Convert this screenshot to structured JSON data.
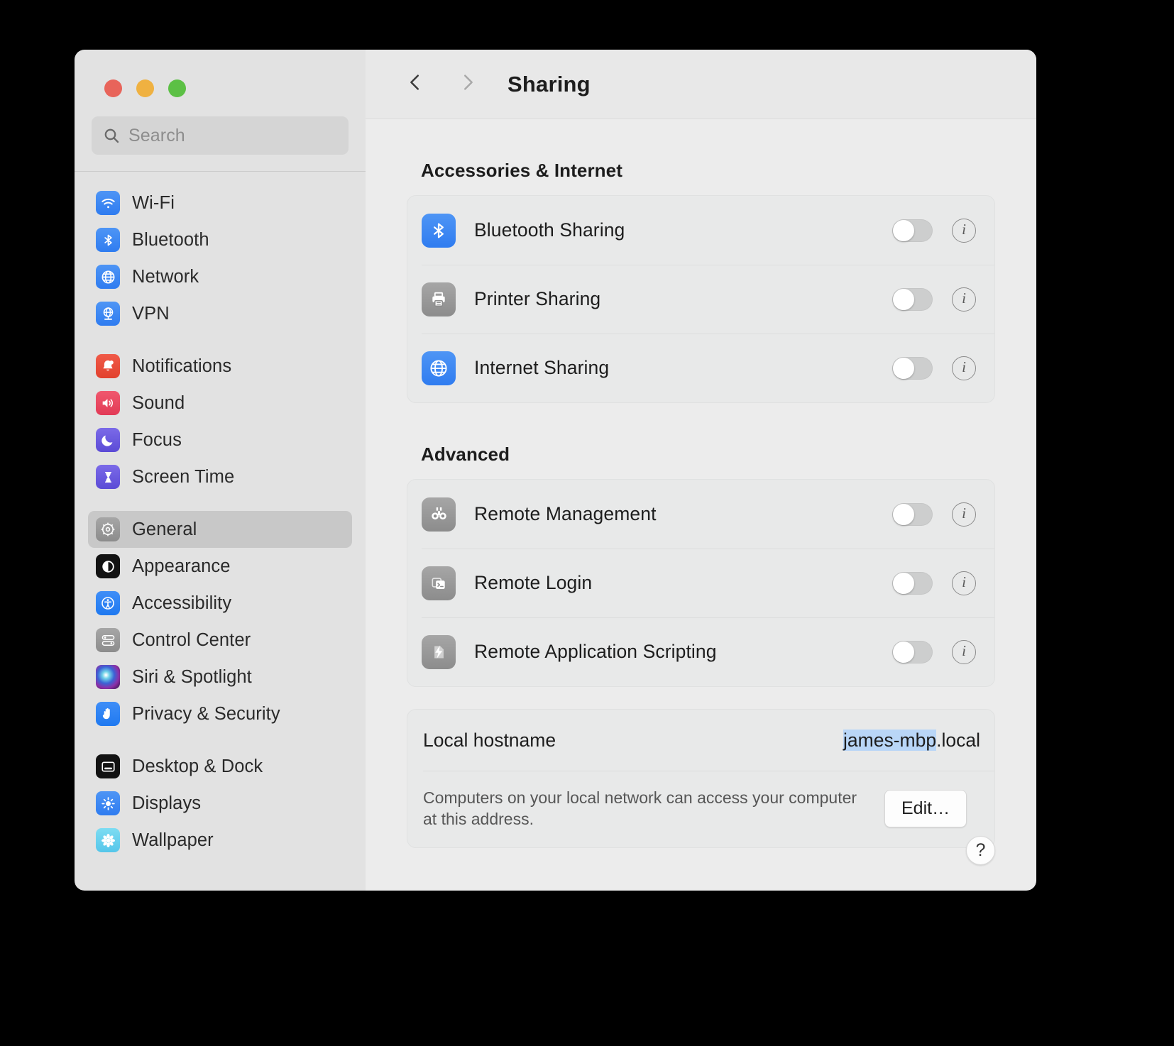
{
  "window": {
    "traffic_lights": [
      {
        "name": "close",
        "color": "#e8645a"
      },
      {
        "name": "minimize",
        "color": "#efb141"
      },
      {
        "name": "zoom",
        "color": "#5cc045"
      }
    ]
  },
  "search": {
    "placeholder": "Search",
    "value": "",
    "icon": "search-icon"
  },
  "sidebar": {
    "groups": [
      {
        "items": [
          {
            "label": "Wi-Fi",
            "icon": "wifi-icon",
            "selected": false
          },
          {
            "label": "Bluetooth",
            "icon": "bluetooth-icon",
            "selected": false
          },
          {
            "label": "Network",
            "icon": "globe-icon",
            "selected": false
          },
          {
            "label": "VPN",
            "icon": "vpn-globe-icon",
            "selected": false
          }
        ]
      },
      {
        "items": [
          {
            "label": "Notifications",
            "icon": "bell-icon",
            "selected": false
          },
          {
            "label": "Sound",
            "icon": "speaker-icon",
            "selected": false
          },
          {
            "label": "Focus",
            "icon": "moon-icon",
            "selected": false
          },
          {
            "label": "Screen Time",
            "icon": "hourglass-icon",
            "selected": false
          }
        ]
      },
      {
        "items": [
          {
            "label": "General",
            "icon": "gear-icon",
            "selected": true
          },
          {
            "label": "Appearance",
            "icon": "appearance-icon",
            "selected": false
          },
          {
            "label": "Accessibility",
            "icon": "accessibility-icon",
            "selected": false
          },
          {
            "label": "Control Center",
            "icon": "control-center-icon",
            "selected": false
          },
          {
            "label": "Siri & Spotlight",
            "icon": "siri-icon",
            "selected": false
          },
          {
            "label": "Privacy & Security",
            "icon": "hand-icon",
            "selected": false
          }
        ]
      },
      {
        "items": [
          {
            "label": "Desktop & Dock",
            "icon": "desktop-dock-icon",
            "selected": false
          },
          {
            "label": "Displays",
            "icon": "brightness-icon",
            "selected": false
          },
          {
            "label": "Wallpaper",
            "icon": "wallpaper-icon",
            "selected": false
          }
        ]
      }
    ]
  },
  "header": {
    "title": "Sharing",
    "back_icon": "chevron-left-icon",
    "forward_icon": "chevron-right-icon"
  },
  "main": {
    "sections": [
      {
        "title": "Accessories & Internet",
        "rows": [
          {
            "label": "Bluetooth Sharing",
            "icon": "bluetooth-icon",
            "enabled": false,
            "info": "i"
          },
          {
            "label": "Printer Sharing",
            "icon": "printer-icon",
            "enabled": false,
            "info": "i"
          },
          {
            "label": "Internet Sharing",
            "icon": "globe-icon",
            "enabled": false,
            "info": "i"
          }
        ]
      },
      {
        "title": "Advanced",
        "rows": [
          {
            "label": "Remote Management",
            "icon": "binoculars-icon",
            "enabled": false,
            "info": "i"
          },
          {
            "label": "Remote Login",
            "icon": "terminal-icon",
            "enabled": false,
            "info": "i"
          },
          {
            "label": "Remote Application Scripting",
            "icon": "script-bolt-icon",
            "enabled": false,
            "info": "i"
          }
        ]
      }
    ],
    "hostname": {
      "label": "Local hostname",
      "value_selected": "james-mbp",
      "value_suffix": ".local",
      "description": "Computers on your local network can access your computer at this address.",
      "edit_label": "Edit…"
    },
    "help_label": "?"
  },
  "colors": {
    "accent_blue": "#3b7ff0",
    "selection_blue": "#b9d6f7",
    "sidebar_bg": "#e2e2e2",
    "main_bg": "#ececec",
    "card_bg": "#e8e9e9"
  }
}
